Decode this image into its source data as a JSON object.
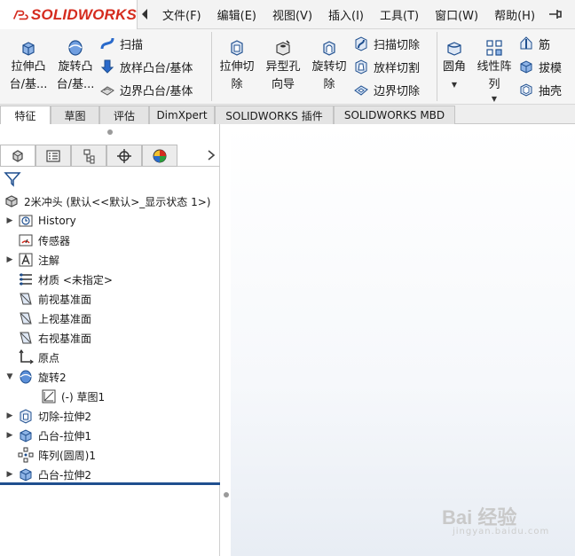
{
  "app": {
    "logo_text": "SOLIDWORKS"
  },
  "menu": {
    "items": [
      "文件(F)",
      "编辑(E)",
      "视图(V)",
      "插入(I)",
      "工具(T)",
      "窗口(W)",
      "帮助(H)"
    ]
  },
  "ribbon": {
    "extrude_boss": [
      "拉伸凸",
      "台/基..."
    ],
    "revolve_boss": [
      "旋转凸",
      "台/基..."
    ],
    "sweep": "扫描",
    "loft": "放样凸台/基体",
    "boundary_boss": "边界凸台/基体",
    "extrude_cut": [
      "拉伸切",
      "除"
    ],
    "hole_wizard": [
      "异型孔",
      "向导"
    ],
    "revolve_cut": [
      "旋转切",
      "除"
    ],
    "swept_cut": "扫描切除",
    "lofted_cut": "放样切割",
    "boundary_cut": "边界切除",
    "fillet": "圆角",
    "linear_pattern": [
      "线性阵",
      "列"
    ],
    "rib": "筋",
    "draft": "拔模",
    "shell": "抽壳"
  },
  "tabs": [
    "特征",
    "草图",
    "评估",
    "DimXpert",
    "SOLIDWORKS 插件",
    "SOLIDWORKS MBD"
  ],
  "tree": {
    "root": "2米冲头 (默认<<默认>_显示状态 1>)",
    "history": "History",
    "sensors": "传感器",
    "annotations": "注解",
    "material": "材质 <未指定>",
    "front_plane": "前视基准面",
    "top_plane": "上视基准面",
    "right_plane": "右视基准面",
    "origin": "原点",
    "revolve2": "旋转2",
    "sketch1": "(-) 草图1",
    "cut_extrude2": "切除-拉伸2",
    "boss_extrude1": "凸台-拉伸1",
    "pattern_circular1": "阵列(圆周)1",
    "boss_extrude2": "凸台-拉伸2"
  },
  "watermark": {
    "text": "Bai 经验",
    "sub": "jingyan.baidu.com"
  },
  "colors": {
    "brand_red": "#d52b1e",
    "feature_blue": "#1f5fbf",
    "rollback": "#1f4f8f"
  }
}
